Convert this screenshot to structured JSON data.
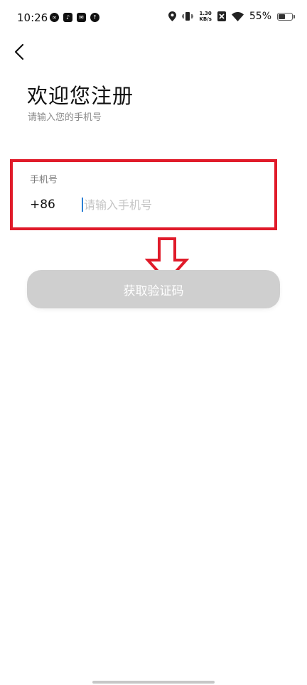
{
  "status_bar": {
    "time": "10:26",
    "net_speed_value": "1.30",
    "net_speed_unit": "KB/s",
    "battery_text": "55%",
    "battery_level": 0.55,
    "icons": [
      "swirl-icon",
      "tiktok-icon",
      "message-icon",
      "upload-icon",
      "location-icon",
      "vibrate-icon",
      "sim-off-icon",
      "wifi-icon",
      "battery-icon"
    ]
  },
  "header": {
    "back_icon": "chevron-left-icon",
    "title": "欢迎您注册",
    "subtitle": "请输入您的手机号"
  },
  "phone_form": {
    "label": "手机号",
    "country_code": "+86",
    "value": "",
    "placeholder": "请输入手机号"
  },
  "actions": {
    "get_code_label": "获取验证码"
  },
  "colors": {
    "highlight_border": "#e01b2a",
    "button_disabled_bg": "#cfcfcf",
    "cursor": "#2b7fd4"
  }
}
